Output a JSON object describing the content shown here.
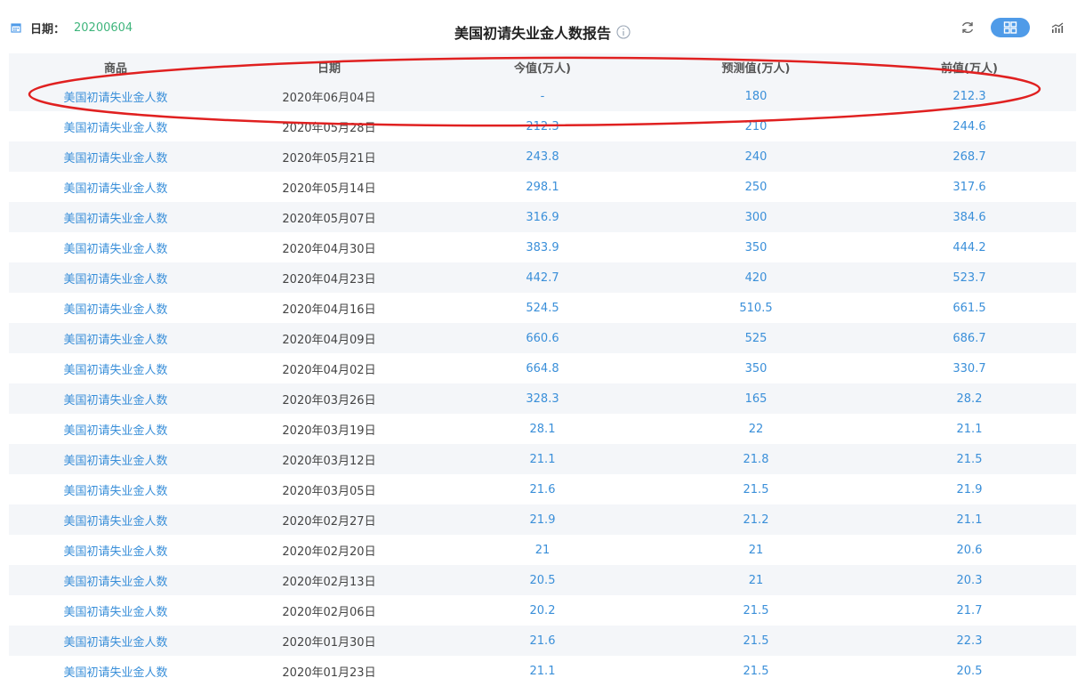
{
  "header": {
    "date_label": "日期：",
    "date_value": "20200604",
    "title": "美国初请失业金人数报告"
  },
  "table": {
    "columns": [
      "商品",
      "日期",
      "今值(万人)",
      "预测值(万人)",
      "前值(万人)"
    ],
    "rows": [
      [
        "美国初请失业金人数",
        "2020年06月04日",
        "-",
        "180",
        "212.3"
      ],
      [
        "美国初请失业金人数",
        "2020年05月28日",
        "212.3",
        "210",
        "244.6"
      ],
      [
        "美国初请失业金人数",
        "2020年05月21日",
        "243.8",
        "240",
        "268.7"
      ],
      [
        "美国初请失业金人数",
        "2020年05月14日",
        "298.1",
        "250",
        "317.6"
      ],
      [
        "美国初请失业金人数",
        "2020年05月07日",
        "316.9",
        "300",
        "384.6"
      ],
      [
        "美国初请失业金人数",
        "2020年04月30日",
        "383.9",
        "350",
        "444.2"
      ],
      [
        "美国初请失业金人数",
        "2020年04月23日",
        "442.7",
        "420",
        "523.7"
      ],
      [
        "美国初请失业金人数",
        "2020年04月16日",
        "524.5",
        "510.5",
        "661.5"
      ],
      [
        "美国初请失业金人数",
        "2020年04月09日",
        "660.6",
        "525",
        "686.7"
      ],
      [
        "美国初请失业金人数",
        "2020年04月02日",
        "664.8",
        "350",
        "330.7"
      ],
      [
        "美国初请失业金人数",
        "2020年03月26日",
        "328.3",
        "165",
        "28.2"
      ],
      [
        "美国初请失业金人数",
        "2020年03月19日",
        "28.1",
        "22",
        "21.1"
      ],
      [
        "美国初请失业金人数",
        "2020年03月12日",
        "21.1",
        "21.8",
        "21.5"
      ],
      [
        "美国初请失业金人数",
        "2020年03月05日",
        "21.6",
        "21.5",
        "21.9"
      ],
      [
        "美国初请失业金人数",
        "2020年02月27日",
        "21.9",
        "21.2",
        "21.1"
      ],
      [
        "美国初请失业金人数",
        "2020年02月20日",
        "21",
        "21",
        "20.6"
      ],
      [
        "美国初请失业金人数",
        "2020年02月13日",
        "20.5",
        "21",
        "20.3"
      ],
      [
        "美国初请失业金人数",
        "2020年02月06日",
        "20.2",
        "21.5",
        "21.7"
      ],
      [
        "美国初请失业金人数",
        "2020年01月30日",
        "21.6",
        "21.5",
        "22.3"
      ],
      [
        "美国初请失业金人数",
        "2020年01月23日",
        "21.1",
        "21.5",
        "20.5"
      ]
    ]
  },
  "colors": {
    "accent_blue": "#3a8fd9",
    "date_green": "#3fb57c",
    "annotation_red": "#e02020",
    "toggle_blue": "#4f9be8"
  },
  "icons": {
    "calendar": "calendar-icon",
    "info": "info-icon",
    "refresh": "refresh-icon",
    "grid_view": "grid-view-icon",
    "chart_view": "chart-view-icon"
  }
}
